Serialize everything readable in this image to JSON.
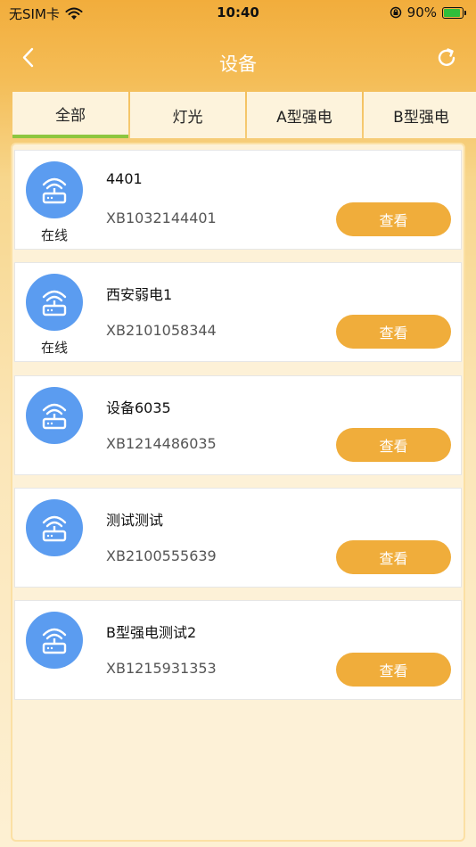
{
  "status_bar": {
    "carrier": "无SIM卡",
    "time": "10:40",
    "battery": "90%",
    "battery_level": 0.9
  },
  "navbar": {
    "title": "设备",
    "back_icon": "chevron-left-icon",
    "refresh_icon": "refresh-icon"
  },
  "tabs": [
    {
      "label": "全部",
      "active": true
    },
    {
      "label": "灯光",
      "active": false
    },
    {
      "label": "A型强电",
      "active": false
    },
    {
      "label": "B型强电",
      "active": false
    }
  ],
  "colors": {
    "accent": "#f0ad3b",
    "avatar": "#5b9cf0",
    "active_tab_indicator": "#8dc63f"
  },
  "devices": [
    {
      "name": "4401",
      "serial": "XB1032144401",
      "status": "在线",
      "action": "查看"
    },
    {
      "name": "西安弱电1",
      "serial": "XB2101058344",
      "status": "在线",
      "action": "查看"
    },
    {
      "name": "设备6035",
      "serial": "XB1214486035",
      "status": "",
      "action": "查看"
    },
    {
      "name": "测试测试",
      "serial": "XB2100555639",
      "status": "",
      "action": "查看"
    },
    {
      "name": "B型强电测试2",
      "serial": "XB1215931353",
      "status": "",
      "action": "查看"
    }
  ]
}
